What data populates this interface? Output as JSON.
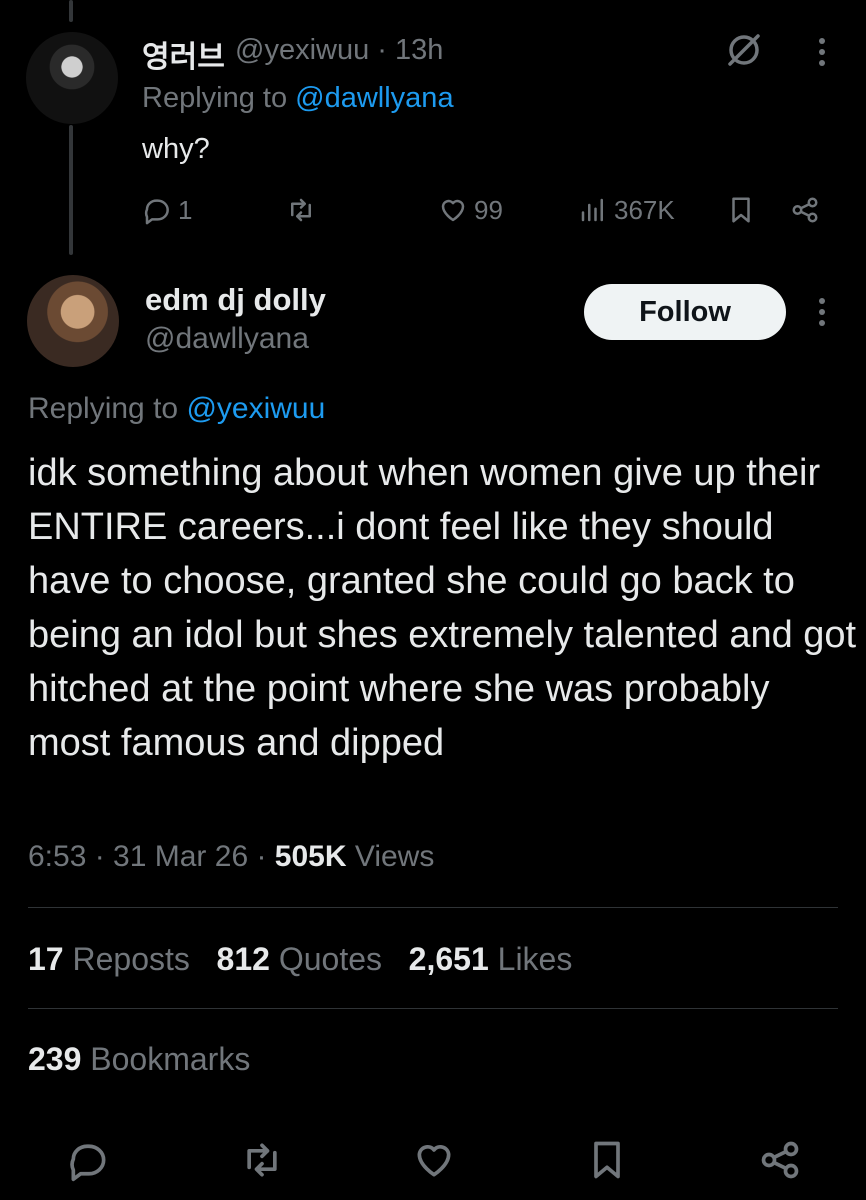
{
  "reply_tweet": {
    "display_name": "영러브",
    "handle_time": "@yexiwuu · 13h",
    "replying_prefix": "Replying to",
    "replying_handle": "@dawllyana",
    "text": "why?",
    "replies": "1",
    "likes": "99",
    "views": "367K"
  },
  "main_tweet": {
    "display_name": "edm dj dolly",
    "handle": "@dawllyana",
    "follow_label": "Follow",
    "replying_prefix": "Replying to",
    "replying_handle": "@yexiwuu",
    "text": "idk something about when women give up their ENTIRE careers...i dont feel like they should have to choose, granted she could go back to being an idol but shes extremely talented and got hitched at the point where she was probably most famous and dipped",
    "time_date": "6:53 · 31 Mar 26 · ",
    "views_count": "505K",
    "views_label": " Views",
    "reposts_count": "17",
    "reposts_label": "Reposts",
    "quotes_count": "812",
    "quotes_label": "Quotes",
    "likes_count": "2,651",
    "likes_label": "Likes",
    "bookmarks_count": "239",
    "bookmarks_label": "Bookmarks"
  },
  "icons": {
    "reply": "reply-icon",
    "repost": "repost-icon",
    "like": "heart-icon",
    "views": "views-icon",
    "bookmark": "bookmark-icon",
    "share": "share-icon",
    "grok": "grok-icon",
    "more": "more-icon"
  },
  "colors": {
    "background": "#000000",
    "text": "#e7e9ea",
    "muted": "#71767b",
    "link": "#1d9bf0",
    "follow_bg": "#eff3f4"
  }
}
